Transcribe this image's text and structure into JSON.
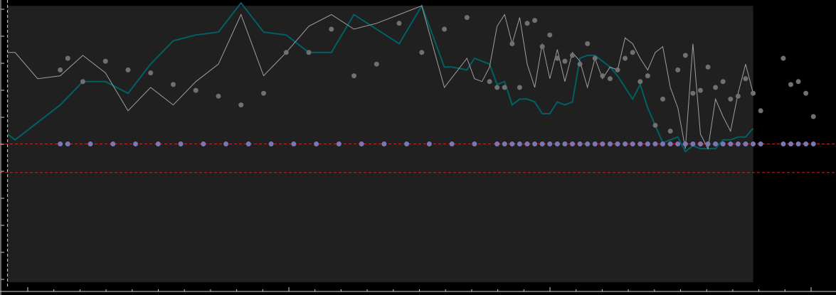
{
  "chart_data": {
    "type": "line",
    "title": "",
    "xlabel": "",
    "ylabel": "",
    "grid": false,
    "legend": "none",
    "xlim": [
      -1,
      110
    ],
    "ylim": [
      0,
      100
    ],
    "shaded_region": {
      "x": [
        0,
        99
      ],
      "y": [
        0,
        98
      ]
    },
    "vertical_reference": {
      "x": 0,
      "style": "dashed",
      "color": "#d8d8d8"
    },
    "horizontal_references": [
      {
        "y": 50.6,
        "style": "dashed",
        "color": "#c0282b"
      },
      {
        "y": 40.8,
        "style": "dashed",
        "color": "#c0282b"
      }
    ],
    "colors": {
      "background": "#000000",
      "plot_area": "#202020",
      "teal_line": "#006064",
      "gray_line": "#9e9e9e",
      "gray_points": "#707070",
      "purple_points": "#7b77b6",
      "axis": "#cfcfcf"
    },
    "series": [
      {
        "kind": "line",
        "color_key": "teal_line",
        "x": [
          0,
          1,
          4,
          7,
          10,
          13,
          16,
          19,
          22,
          25,
          28,
          31,
          34,
          37,
          40,
          43,
          46,
          49,
          52,
          55,
          58,
          59,
          61,
          62,
          63,
          64,
          65,
          66,
          67,
          68,
          69,
          70,
          71,
          72,
          73,
          74,
          75,
          76,
          77,
          78,
          79,
          80,
          81,
          82,
          83,
          84,
          85,
          86,
          87,
          88,
          89,
          90,
          91,
          92,
          93,
          94,
          95,
          96,
          97,
          98,
          99
        ],
        "y": [
          54,
          52,
          58,
          64,
          72,
          72,
          68,
          78,
          86,
          88,
          89,
          99,
          89,
          88,
          82,
          82,
          95,
          90,
          85,
          98,
          77,
          77,
          76,
          80,
          79,
          78,
          71,
          72,
          64,
          66,
          66,
          65,
          61,
          61,
          65,
          64,
          65,
          80,
          81,
          81,
          79,
          77,
          74,
          70,
          66,
          71,
          63,
          57,
          51,
          52,
          53,
          48,
          50,
          49,
          49,
          49,
          52,
          52,
          53,
          53,
          56
        ]
      },
      {
        "kind": "line",
        "color_key": "gray_line",
        "x": [
          0,
          1,
          4,
          7,
          10,
          13,
          16,
          19,
          22,
          25,
          28,
          31,
          34,
          37,
          40,
          43,
          46,
          49,
          52,
          55,
          58,
          61,
          62,
          63,
          64,
          65,
          66,
          67,
          68,
          69,
          70,
          71,
          72,
          73,
          74,
          75,
          76,
          77,
          78,
          79,
          80,
          81,
          82,
          83,
          84,
          85,
          86,
          87,
          88,
          89,
          90,
          91,
          92,
          93,
          94,
          95,
          96,
          97,
          98,
          99
        ],
        "y": [
          82,
          82,
          73,
          74,
          81,
          75,
          62,
          70,
          64,
          72,
          78,
          95,
          74,
          82,
          91,
          95,
          90,
          92,
          95,
          98,
          70,
          80,
          73,
          72,
          77,
          91,
          95,
          85,
          94,
          78,
          70,
          85,
          73,
          83,
          72,
          82,
          79,
          70,
          80,
          73,
          77,
          76,
          87,
          85,
          80,
          76,
          82,
          84,
          70,
          63,
          49,
          85,
          54,
          49,
          66,
          60,
          55,
          68,
          78,
          68
        ]
      },
      {
        "kind": "scatter",
        "color_key": "gray_points",
        "x": [
          7,
          8,
          10,
          13,
          16,
          19,
          22,
          25,
          28,
          31,
          34,
          37,
          40,
          43,
          46,
          49,
          52,
          55,
          58,
          61,
          64,
          65,
          66,
          67,
          68,
          69,
          70,
          71,
          72,
          73,
          74,
          75,
          76,
          77,
          78,
          79,
          80,
          81,
          82,
          83,
          84,
          85,
          86,
          87,
          88,
          89,
          90,
          91,
          92,
          93,
          94,
          95,
          96,
          97,
          98,
          99,
          100,
          103,
          104,
          105,
          106,
          107
        ],
        "y": [
          76,
          80,
          72,
          79,
          76,
          75,
          71,
          69,
          67,
          64,
          68,
          82,
          82,
          90,
          74,
          78,
          92,
          82,
          90,
          94,
          72,
          70,
          70,
          85,
          70,
          92,
          93,
          84,
          88,
          80,
          79,
          81,
          78,
          85,
          80,
          74,
          73,
          76,
          80,
          82,
          72,
          74,
          57,
          66,
          55,
          76,
          81,
          68,
          69,
          77,
          70,
          72,
          66,
          67,
          73,
          68,
          62,
          80,
          71,
          72,
          68,
          60
        ]
      },
      {
        "kind": "scatter",
        "color_key": "purple_points",
        "x": [
          7,
          8,
          11,
          14,
          17,
          20,
          23,
          26,
          29,
          32,
          35,
          38,
          41,
          44,
          47,
          50,
          53,
          56,
          59,
          62,
          65,
          66,
          67,
          68,
          69,
          70,
          71,
          72,
          73,
          74,
          75,
          76,
          77,
          78,
          79,
          80,
          81,
          82,
          83,
          84,
          85,
          86,
          87,
          88,
          89,
          90,
          91,
          92,
          93,
          94,
          95,
          96,
          97,
          98,
          99,
          100,
          103,
          104,
          105,
          106,
          107
        ],
        "y": [
          50.6,
          50.6,
          50.6,
          50.6,
          50.6,
          50.6,
          50.6,
          50.6,
          50.6,
          50.6,
          50.6,
          50.6,
          50.6,
          50.6,
          50.6,
          50.6,
          50.6,
          50.6,
          50.6,
          50.6,
          50.6,
          50.6,
          50.6,
          50.6,
          50.6,
          50.6,
          50.6,
          50.6,
          50.6,
          50.6,
          50.6,
          50.6,
          50.6,
          50.6,
          50.6,
          50.6,
          50.6,
          50.6,
          50.6,
          50.6,
          50.6,
          50.6,
          50.6,
          50.6,
          50.6,
          50.6,
          50.6,
          50.6,
          50.6,
          50.6,
          50.6,
          50.6,
          50.6,
          50.6,
          50.6,
          50.6,
          50.6,
          50.6,
          50.6,
          50.6,
          50.6
        ]
      }
    ]
  }
}
